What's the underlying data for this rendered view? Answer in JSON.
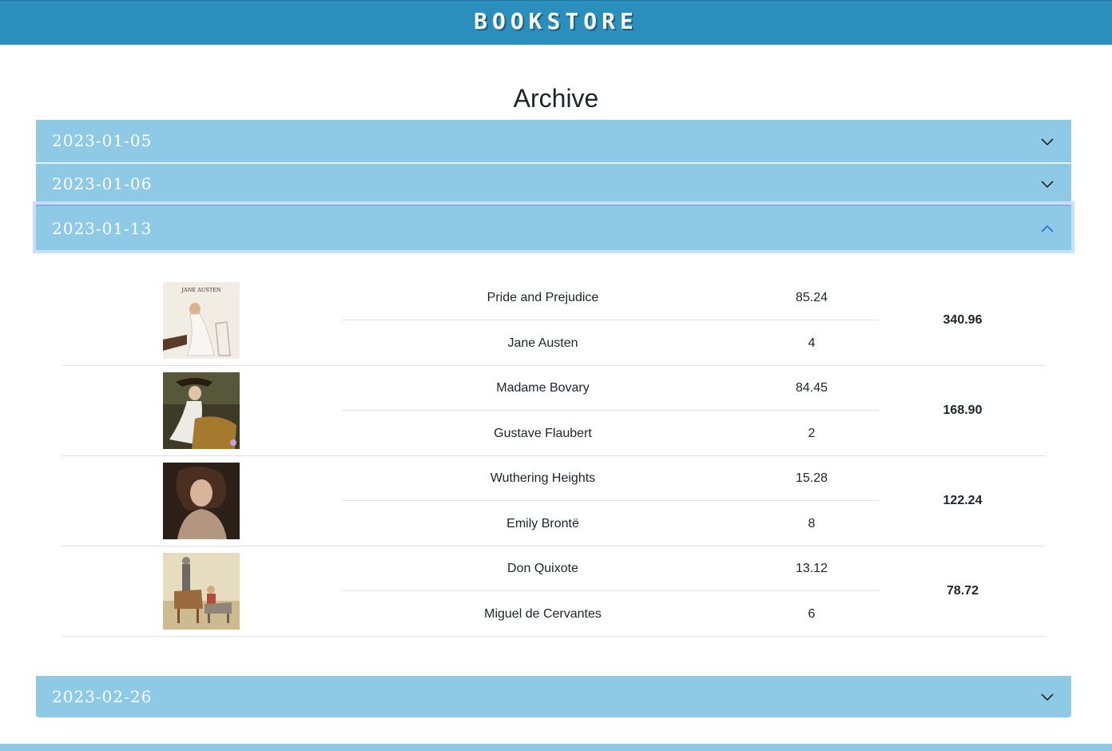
{
  "header": {
    "brand": "BOOKSTORE"
  },
  "page_title": "Archive",
  "colors": {
    "topbar": "#2b8fbd",
    "accordion": "#8ecae6",
    "expanded_chevron": "#1a73e8"
  },
  "accordion": [
    {
      "date": "2023-01-05",
      "expanded": false
    },
    {
      "date": "2023-01-06",
      "expanded": false
    },
    {
      "date": "2023-01-13",
      "expanded": true,
      "orders": [
        {
          "cover": "jane-austen-cover",
          "title": "Pride and Prejudice",
          "price": "85.24",
          "author": "Jane Austen",
          "quantity": "4",
          "total": "340.96"
        },
        {
          "cover": "madame-bovary-cover",
          "title": "Madame Bovary",
          "price": "84.45",
          "author": "Gustave Flaubert",
          "quantity": "2",
          "total": "168.90"
        },
        {
          "cover": "wuthering-heights-cover",
          "title": "Wuthering Heights",
          "price": "15.28",
          "author": "Emily Brontë",
          "quantity": "8",
          "total": "122.24"
        },
        {
          "cover": "don-quixote-cover",
          "title": "Don Quixote",
          "price": "13.12",
          "author": "Miguel de Cervantes",
          "quantity": "6",
          "total": "78.72"
        }
      ]
    },
    {
      "date": "2023-02-26",
      "expanded": false
    }
  ]
}
